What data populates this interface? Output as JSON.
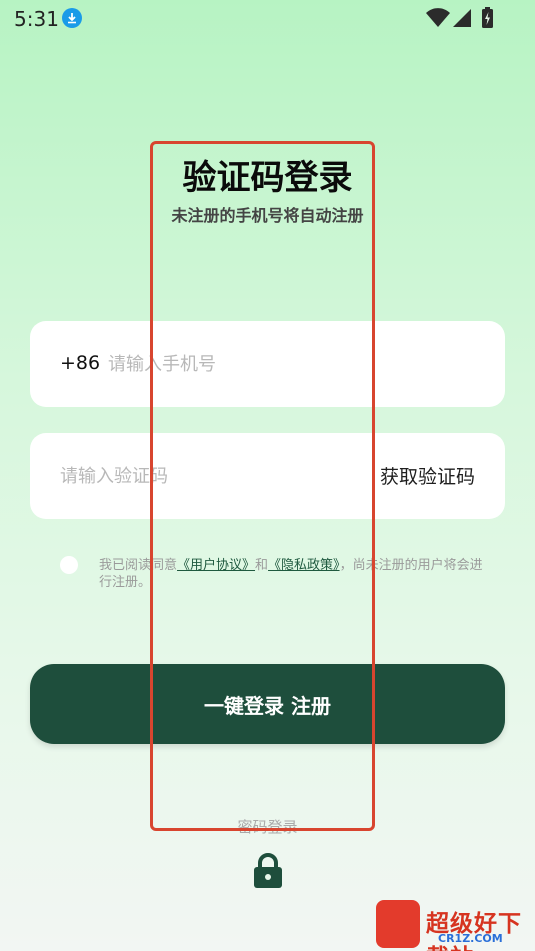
{
  "status_bar": {
    "time": "5:31"
  },
  "header": {
    "title": "验证码登录",
    "subtitle": "未注册的手机号将自动注册"
  },
  "phone_field": {
    "country_code": "+86",
    "placeholder": "请输入手机号"
  },
  "code_field": {
    "placeholder": "请输入验证码",
    "get_code_label": "获取验证码"
  },
  "agreement": {
    "prefix": "我已阅读同意",
    "user_agreement": "《用户协议》",
    "and": "和",
    "privacy_policy": "《隐私政策》",
    "suffix": "，尚未注册的用户将会进行注册。"
  },
  "login_button_label": "一键登录 注册",
  "password_login_label": "密码登录",
  "watermark": {
    "text": "超级好下载站",
    "sub": "CR1Z.COM"
  },
  "icons": {
    "download": "download-icon",
    "wifi": "wifi-icon",
    "signal": "signal-icon",
    "battery": "battery-icon",
    "lock": "lock-icon"
  },
  "colors": {
    "primary_button": "#1e4e3c",
    "link": "#1f5a3f",
    "highlight_border": "#d8452f",
    "download_badge": "#1a9be8"
  }
}
